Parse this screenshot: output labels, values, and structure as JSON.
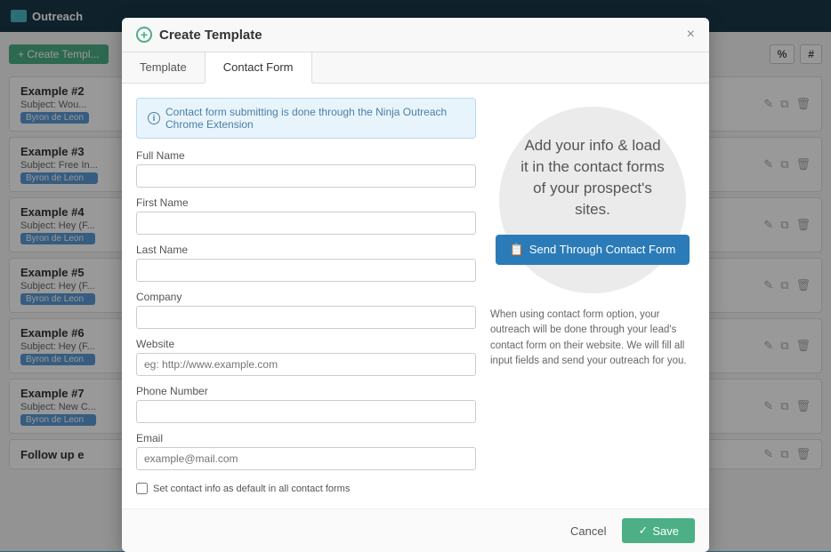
{
  "app": {
    "name": "Outreach"
  },
  "nav": {
    "logo_label": "Outreach",
    "buttons": [
      "%",
      "#"
    ]
  },
  "bg_list": {
    "create_button": "+ Create Templ...",
    "items": [
      {
        "title": "Example #2",
        "subject": "Subject: Wou...",
        "tag": "Byron de Leon"
      },
      {
        "title": "Example #3",
        "subject": "Subject: Free In...",
        "tag": "Byron de Leon"
      },
      {
        "title": "Example #4",
        "subject": "Subject: Hey (F...",
        "tag": "Byron de Leon"
      },
      {
        "title": "Example #5",
        "subject": "Subject: Hey (F...",
        "tag": "Byron de Leon"
      },
      {
        "title": "Example #6",
        "subject": "Subject: Hey (F...",
        "tag": "Byron de Leon"
      },
      {
        "title": "Example #7",
        "subject": "Subject: New C...",
        "tag": "Byron de Leon"
      },
      {
        "title": "Follow up e",
        "subject": "",
        "tag": ""
      }
    ]
  },
  "modal": {
    "title": "Create Template",
    "close_label": "×",
    "tabs": [
      {
        "label": "Template",
        "active": false
      },
      {
        "label": "Contact Form",
        "active": true
      }
    ],
    "info_banner": "Contact form submitting is done through the Ninja Outreach Chrome Extension",
    "info_icon": "i",
    "form": {
      "fields": [
        {
          "label": "Full Name",
          "placeholder": "",
          "type": "text"
        },
        {
          "label": "First Name",
          "placeholder": "",
          "type": "text"
        },
        {
          "label": "Last Name",
          "placeholder": "",
          "type": "text"
        },
        {
          "label": "Company",
          "placeholder": "",
          "type": "text"
        },
        {
          "label": "Website",
          "placeholder": "eg: http://www.example.com",
          "type": "text"
        },
        {
          "label": "Phone Number",
          "placeholder": "",
          "type": "text"
        },
        {
          "label": "Email",
          "placeholder": "example@mail.com",
          "type": "text"
        }
      ],
      "checkbox_label": "Set contact info as default in all contact forms"
    },
    "right_panel": {
      "circle_text": "Add your info & load it in the contact forms of your prospect's sites.",
      "send_button": "Send Through Contact Form",
      "info_text": "When using contact form option, your outreach will be done through your lead's contact form on their website. We will fill all input fields and send your outreach for you."
    },
    "footer": {
      "cancel_label": "Cancel",
      "save_label": "Save",
      "save_icon": "✓"
    }
  }
}
